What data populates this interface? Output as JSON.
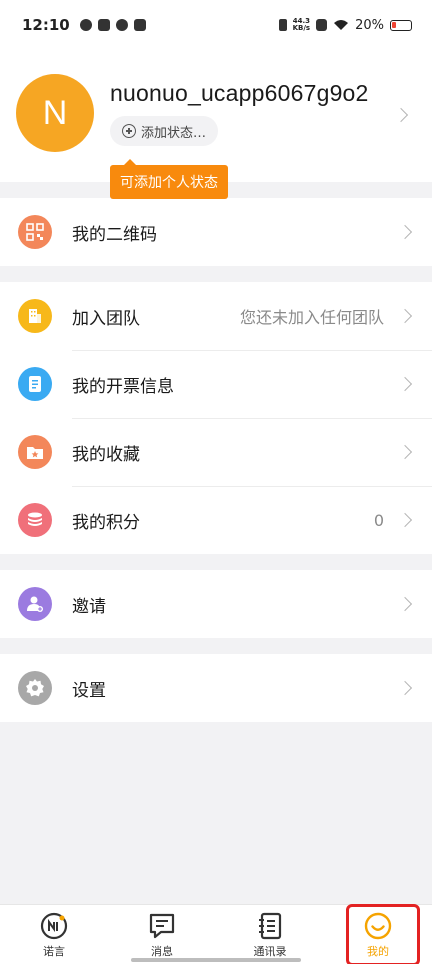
{
  "status_bar": {
    "time": "12:10",
    "net_speed_top": "44.3",
    "net_speed_unit": "KB/s",
    "battery_pct": "20%"
  },
  "profile": {
    "avatar_letter": "N",
    "username": "nuonuo_ucapp6067g9o2",
    "add_status_label": "添加状态…",
    "tooltip": "可添加个人状态"
  },
  "menu": {
    "qr": {
      "label": "我的二维码",
      "icon": "qr-code-icon"
    },
    "team": {
      "label": "加入团队",
      "value": "您还未加入任何团队",
      "icon": "building-icon"
    },
    "invoice": {
      "label": "我的开票信息",
      "icon": "document-icon"
    },
    "favorites": {
      "label": "我的收藏",
      "icon": "folder-star-icon"
    },
    "points": {
      "label": "我的积分",
      "value": "0",
      "icon": "coins-stack-icon"
    },
    "invite": {
      "label": "邀请",
      "icon": "person-add-icon"
    },
    "settings": {
      "label": "设置",
      "icon": "gear-icon"
    }
  },
  "bottom_nav": {
    "items": [
      {
        "label": "诺言",
        "icon": "nuoyan-icon"
      },
      {
        "label": "消息",
        "icon": "message-icon"
      },
      {
        "label": "通讯录",
        "icon": "contacts-icon"
      },
      {
        "label": "我的",
        "icon": "smile-icon",
        "active": true
      }
    ]
  },
  "colors": {
    "accent": "#f5a300",
    "tooltip": "#f88a0d",
    "avatar": "#f6a623",
    "highlight": "#e32222"
  }
}
